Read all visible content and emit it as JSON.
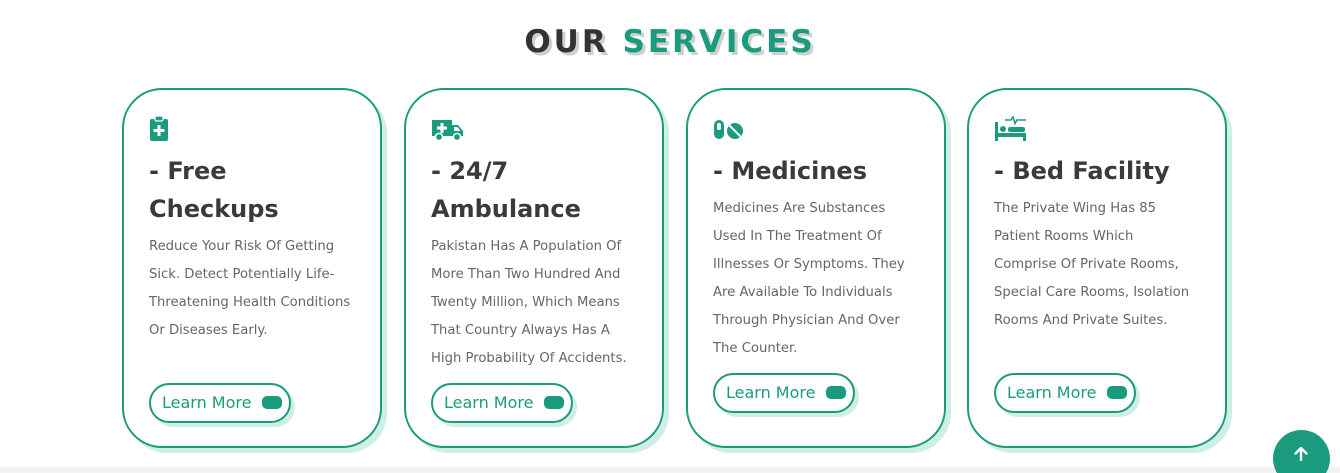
{
  "section": {
    "title_part1": "OUR",
    "title_part2": "SERVICES"
  },
  "cards": [
    {
      "icon": "clipboard-medical-icon",
      "title_line1": "- Free",
      "title_line2": "Checkups",
      "description": "Reduce Your Risk Of Getting Sick. Detect Potentially Life-Threatening Health Conditions Or Diseases Early.",
      "button_label": "Learn More"
    },
    {
      "icon": "ambulance-icon",
      "title_line1": "- 24/7",
      "title_line2": "Ambulance",
      "description": "Pakistan Has A Population Of More Than Two Hundred And Twenty Million, Which Means That Country Always Has A High Probability Of Accidents.",
      "button_label": "Learn More"
    },
    {
      "icon": "pills-icon",
      "title_line1": "- Medicines",
      "description": "Medicines Are Substances Used In The Treatment Of Illnesses Or Symptoms. They Are Available To Individuals Through Physician And Over The Counter.",
      "button_label": "Learn More"
    },
    {
      "icon": "bed-icon",
      "title_line1": "- Bed Facility",
      "description": "The Private Wing Has 85 Patient Rooms Which Comprise Of Private Rooms, Special Care Rooms, Isolation Rooms And Private Suites.",
      "button_label": "Learn More"
    }
  ],
  "scroll_top": {
    "icon": "arrow-up-icon"
  },
  "colors": {
    "accent": "#1a9b7e",
    "heading": "#3a3a3a",
    "text": "#666666"
  }
}
